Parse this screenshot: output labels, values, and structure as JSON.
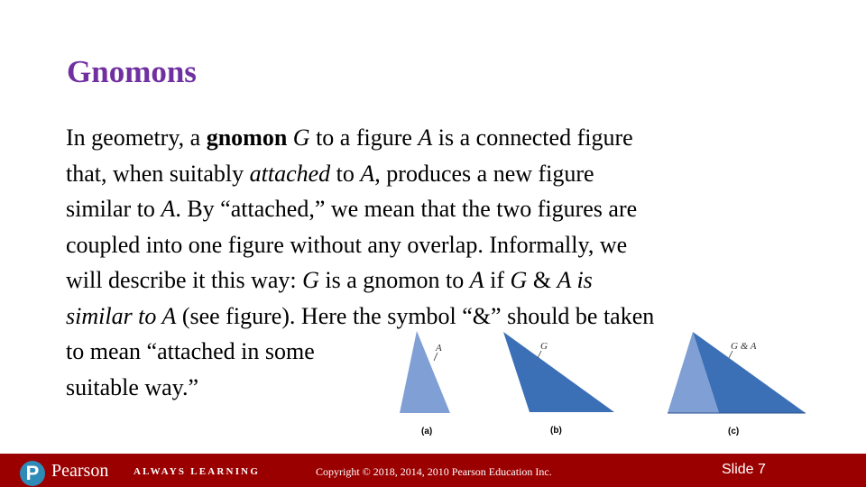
{
  "slide": {
    "title": "Gnomons",
    "body_lines": [
      [
        {
          "t": "In geometry, a "
        },
        {
          "t": "gnomon",
          "b": true
        },
        {
          "t": " "
        },
        {
          "t": "G",
          "i": true
        },
        {
          "t": " to a figure "
        },
        {
          "t": "A",
          "i": true
        },
        {
          "t": " is a connected figure"
        }
      ],
      [
        {
          "t": "that, when suitably "
        },
        {
          "t": "attached",
          "i": true
        },
        {
          "t": " to "
        },
        {
          "t": "A",
          "i": true
        },
        {
          "t": ", produces a new figure"
        }
      ],
      [
        {
          "t": "similar to "
        },
        {
          "t": "A",
          "i": true
        },
        {
          "t": ". By “attached,” we mean that the two figures are"
        }
      ],
      [
        {
          "t": "coupled into one figure without any overlap. Informally, we"
        }
      ],
      [
        {
          "t": "will describe it this way: "
        },
        {
          "t": "G",
          "i": true
        },
        {
          "t": " is a gnomon to "
        },
        {
          "t": "A",
          "i": true
        },
        {
          "t": " if "
        },
        {
          "t": "G",
          "i": true
        },
        {
          "t": " & "
        },
        {
          "t": "A is",
          "i": true
        }
      ],
      [
        {
          "t": "similar to A",
          "i": true
        },
        {
          "t": " (see figure). Here the symbol “&” should be taken"
        }
      ],
      [
        {
          "t": "to mean “attached in some"
        }
      ],
      [
        {
          "t": "suitable way.”"
        }
      ]
    ]
  },
  "figure": {
    "panels": [
      {
        "caption": "(a)",
        "label": "A"
      },
      {
        "caption": "(b)",
        "label": "G"
      },
      {
        "caption": "(c)",
        "label": "G & A"
      }
    ],
    "colors": {
      "light": "#7f9fd5",
      "dark": "#3b6fb6"
    }
  },
  "footer": {
    "logo_letter": "P",
    "brand": "Pearson",
    "tagline": "ALWAYS LEARNING",
    "copyright": "Copyright © 2018, 2014, 2010 Pearson Education Inc.",
    "slide_number": "Slide 7"
  }
}
